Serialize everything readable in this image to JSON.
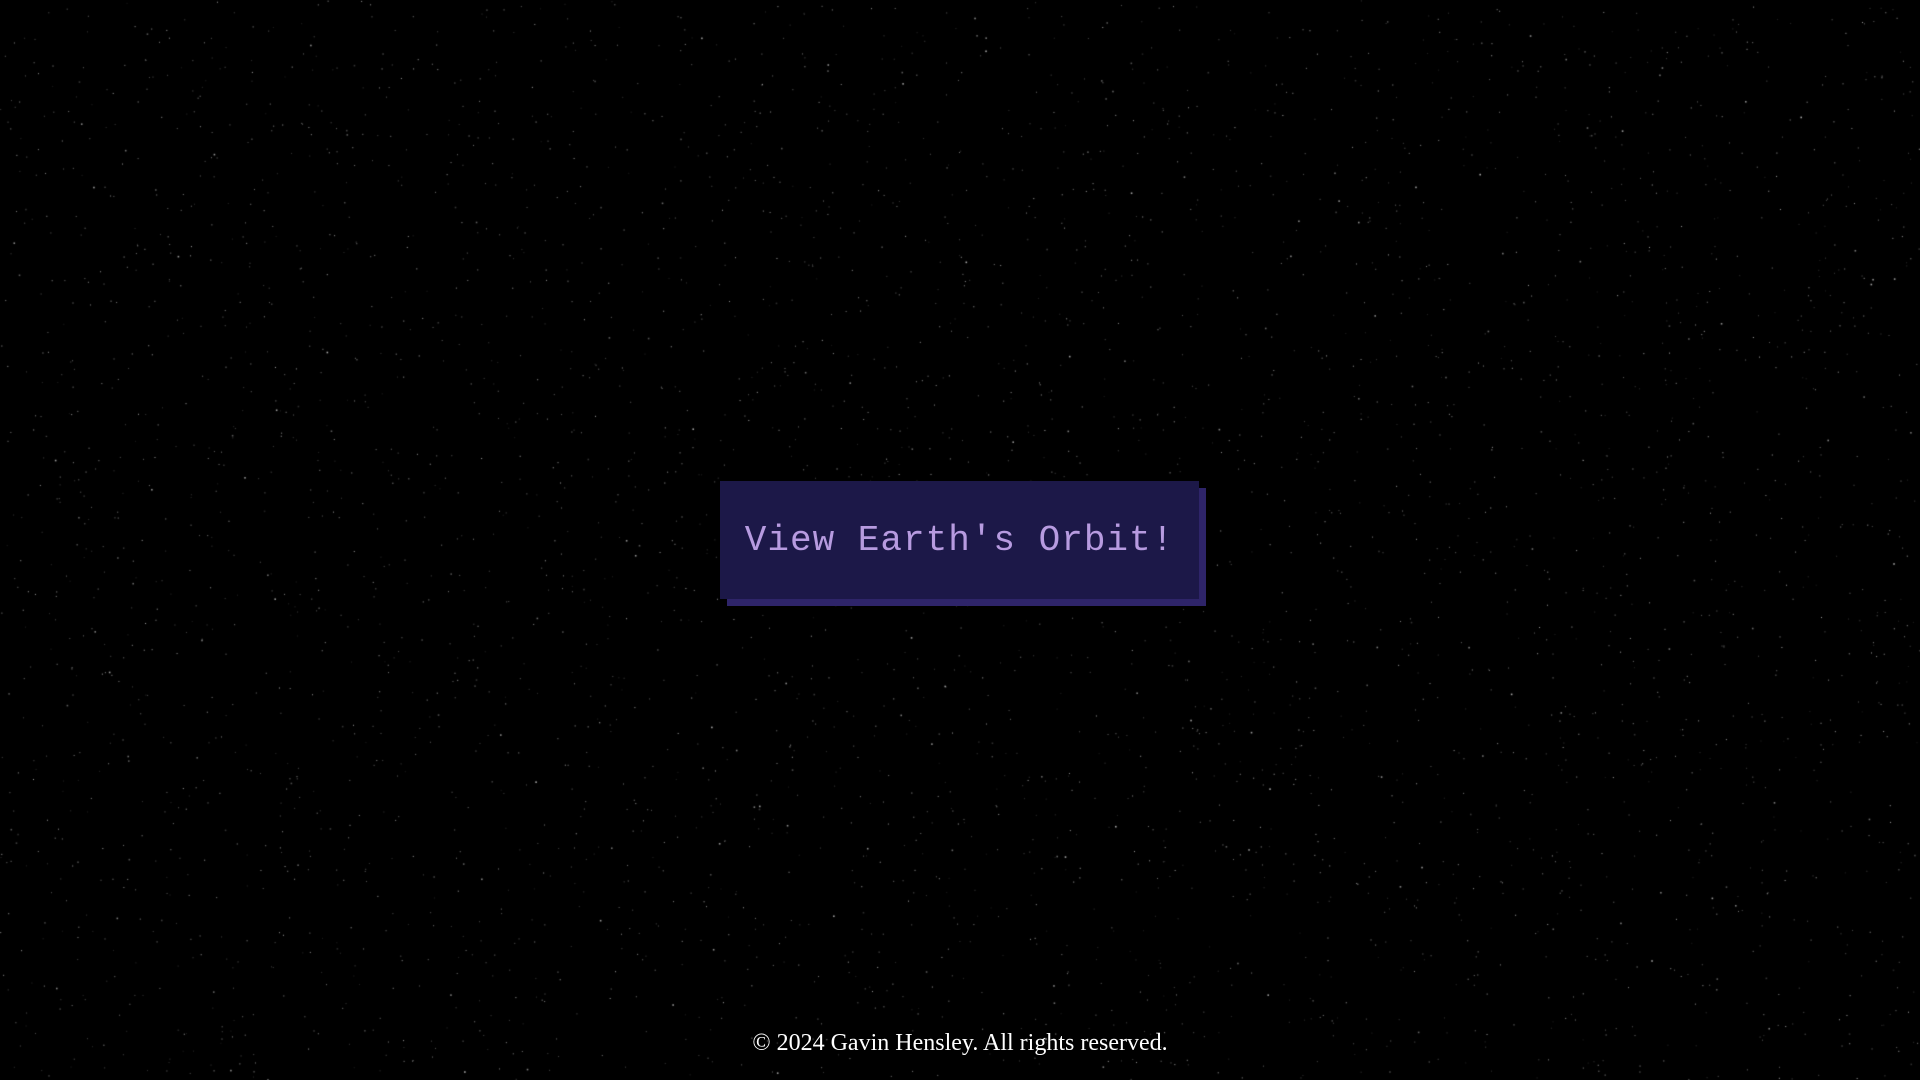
{
  "main": {
    "orbit_button_label": "View Earth's Orbit!"
  },
  "footer": {
    "copyright": "© 2024 Gavin Hensley. All rights reserved."
  },
  "colors": {
    "background": "#000000",
    "star": "#ffffff",
    "button_bg": "#1c1848",
    "button_shadow": "#2e2469",
    "button_text": "#b79be0",
    "footer_text": "#ffffff"
  }
}
